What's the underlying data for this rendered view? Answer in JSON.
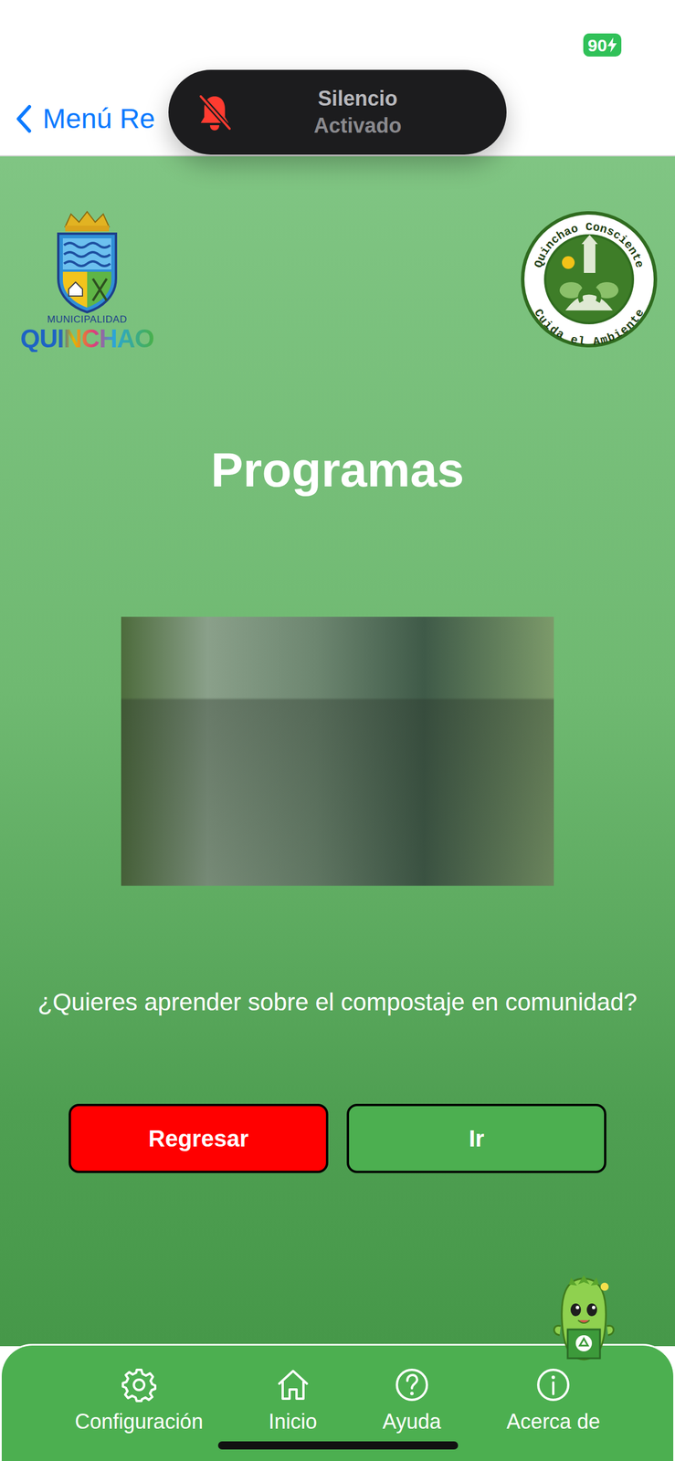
{
  "status_bar": {
    "battery": "90",
    "charging": true
  },
  "nav": {
    "back_label": "Menú Re"
  },
  "notification": {
    "title": "Silencio",
    "subtitle": "Activado"
  },
  "logos": {
    "left": {
      "top": "MUNICIPALIDAD",
      "name": "QUINCHAO"
    },
    "right": {
      "top": "Quinchao Consciente",
      "bottom": "Cuida el Ambiente"
    }
  },
  "title": "Programas",
  "question": "¿Quieres aprender sobre el compostaje en comunidad?",
  "buttons": [
    {
      "label": "Regresar",
      "kind": "back"
    },
    {
      "label": "Ir",
      "kind": "go"
    }
  ],
  "tab_bar": [
    {
      "label": "Configuración",
      "kind": "settings"
    },
    {
      "label": "Inicio",
      "kind": "home"
    },
    {
      "label": "Ayuda",
      "kind": "help"
    },
    {
      "label": "Acerca de",
      "kind": "info"
    }
  ]
}
